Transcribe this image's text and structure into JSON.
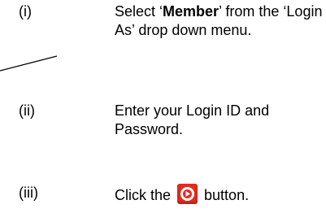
{
  "steps": [
    {
      "number": "(i)",
      "text_before": "Select ‘",
      "bold": "Member",
      "text_after": "’   from the ‘Login As’ drop down menu."
    },
    {
      "number": "(ii)",
      "text": "Enter your Login ID and Password."
    },
    {
      "number": "(iii)",
      "text_before": "Click  the ",
      "icon": "go-button-icon",
      "text_after": " button."
    }
  ],
  "colors": {
    "go_button": "#e52a1f"
  }
}
